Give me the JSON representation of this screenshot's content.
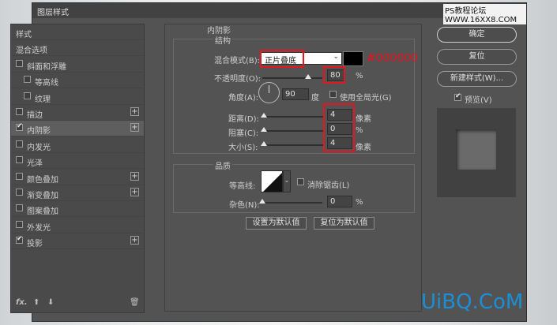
{
  "window": {
    "title": "图层样式",
    "watermark": "PS教程论坛 WWW.16XX8.COM"
  },
  "left_panel": {
    "items": [
      {
        "label": "样式",
        "checkbox": false,
        "checked": false,
        "plus": false,
        "indent": 0,
        "selected": false
      },
      {
        "label": "混合选项",
        "checkbox": false,
        "checked": false,
        "plus": false,
        "indent": 0,
        "selected": false
      },
      {
        "label": "斜面和浮雕",
        "checkbox": true,
        "checked": false,
        "plus": false,
        "indent": 0,
        "selected": false
      },
      {
        "label": "等高线",
        "checkbox": true,
        "checked": false,
        "plus": false,
        "indent": 1,
        "selected": false
      },
      {
        "label": "纹理",
        "checkbox": true,
        "checked": false,
        "plus": false,
        "indent": 1,
        "selected": false
      },
      {
        "label": "描边",
        "checkbox": true,
        "checked": false,
        "plus": true,
        "indent": 0,
        "selected": false
      },
      {
        "label": "内阴影",
        "checkbox": true,
        "checked": true,
        "plus": true,
        "indent": 0,
        "selected": true
      },
      {
        "label": "内发光",
        "checkbox": true,
        "checked": false,
        "plus": false,
        "indent": 0,
        "selected": false
      },
      {
        "label": "光泽",
        "checkbox": true,
        "checked": false,
        "plus": false,
        "indent": 0,
        "selected": false
      },
      {
        "label": "颜色叠加",
        "checkbox": true,
        "checked": false,
        "plus": true,
        "indent": 0,
        "selected": false
      },
      {
        "label": "渐变叠加",
        "checkbox": true,
        "checked": false,
        "plus": true,
        "indent": 0,
        "selected": false
      },
      {
        "label": "图案叠加",
        "checkbox": true,
        "checked": false,
        "plus": false,
        "indent": 0,
        "selected": false
      },
      {
        "label": "外发光",
        "checkbox": true,
        "checked": false,
        "plus": false,
        "indent": 0,
        "selected": false
      },
      {
        "label": "投影",
        "checkbox": true,
        "checked": true,
        "plus": true,
        "indent": 0,
        "selected": false
      }
    ],
    "bottom": {
      "fx": "fx.",
      "up": "⬆",
      "down": "⬇",
      "trash": "🗑"
    }
  },
  "inner_shadow": {
    "group_title": "内阴影",
    "structure_title": "结构",
    "blend_mode_label": "混合模式(B):",
    "blend_mode_value": "正片叠底",
    "color_hex": "#000000",
    "opacity_label": "不透明度(O):",
    "opacity_value": "80",
    "opacity_unit": "%",
    "angle_label": "角度(A):",
    "angle_value": "90",
    "angle_unit": "度",
    "global_light_label": "使用全局光(G)",
    "global_light_checked": false,
    "distance_label": "距离(D):",
    "distance_value": "4",
    "distance_unit": "像素",
    "choke_label": "阻塞(C):",
    "choke_value": "0",
    "choke_unit": "%",
    "size_label": "大小(S):",
    "size_value": "4",
    "size_unit": "像素",
    "quality_title": "品质",
    "contour_label": "等高线:",
    "antialias_label": "消除锯齿(L)",
    "antialias_checked": false,
    "noise_label": "杂色(N):",
    "noise_value": "0",
    "noise_unit": "%",
    "set_default_button": "设置为默认值",
    "reset_default_button": "复位为默认值"
  },
  "right_panel": {
    "ok_button": "确定",
    "reset_button": "复位",
    "new_style_button": "新建样式(W)...",
    "preview_label": "预览(V)",
    "preview_checked": true
  },
  "annotation": {
    "color_label": "#000000",
    "color": "#e8141e"
  },
  "brand_watermark": "UiBQ.CoM"
}
